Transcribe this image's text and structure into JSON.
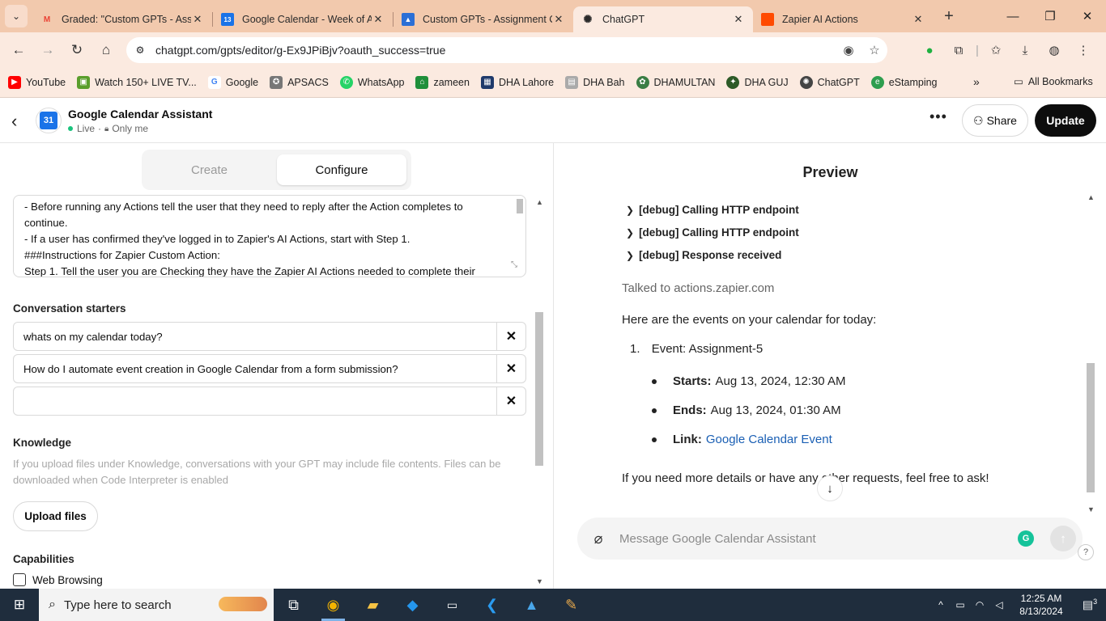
{
  "browser": {
    "tabs": [
      {
        "title": "Graded: \"Custom GPTs - Ass",
        "icon": "gmail-icon",
        "active": false
      },
      {
        "title": "Google Calendar - Week of A",
        "icon": "calendar-icon",
        "active": false
      },
      {
        "title": "Custom GPTs - Assignment C",
        "icon": "classroom-icon",
        "active": false
      },
      {
        "title": "ChatGPT",
        "icon": "chatgpt-icon",
        "active": true
      },
      {
        "title": "Zapier AI Actions",
        "icon": "zapier-icon",
        "active": false
      }
    ],
    "url": "chatgpt.com/gpts/editor/g-Ex9JPiBjv?oauth_success=true",
    "bookmarks": [
      {
        "label": "YouTube",
        "color": "#ff0000",
        "glyph": "▶"
      },
      {
        "label": "Watch 150+ LIVE TV...",
        "color": "#5a9e2c",
        "glyph": "▣"
      },
      {
        "label": "Google",
        "color": "#4285f4",
        "glyph": "G"
      },
      {
        "label": "APSACS",
        "color": "#555555",
        "glyph": "✪"
      },
      {
        "label": "WhatsApp",
        "color": "#25d366",
        "glyph": "✆"
      },
      {
        "label": "zameen",
        "color": "#1f8f3a",
        "glyph": "⌂"
      },
      {
        "label": "DHA Lahore",
        "color": "#1f3a6b",
        "glyph": "▦"
      },
      {
        "label": "DHA Bah",
        "color": "#999999",
        "glyph": "▤"
      },
      {
        "label": "DHAMULTAN",
        "color": "#3a7d44",
        "glyph": "✿"
      },
      {
        "label": "DHA GUJ",
        "color": "#2d5a27",
        "glyph": "✦"
      },
      {
        "label": "ChatGPT",
        "color": "#444444",
        "glyph": "✺"
      },
      {
        "label": "eStamping",
        "color": "#2e9e4f",
        "glyph": "e"
      }
    ],
    "all_bookmarks": "All Bookmarks"
  },
  "header": {
    "gpt_name": "Google Calendar Assistant",
    "avatar_text": "31",
    "status": "Live",
    "visibility": "Only me",
    "share_label": "Share",
    "update_label": "Update"
  },
  "editor": {
    "tab_create": "Create",
    "tab_configure": "Configure",
    "instructions_lines": [
      "- Before running any Actions tell the user that they need to reply after the Action completes to",
      "continue.",
      "- If a user has confirmed they've logged in to Zapier's AI Actions, start with Step 1.",
      "###Instructions for Zapier Custom Action:",
      "Step 1. Tell the user you are Checking they have the Zapier AI Actions needed to complete their"
    ],
    "starters_title": "Conversation starters",
    "starters": [
      "whats on my calendar today?",
      "How do I automate event creation in Google Calendar from a form submission?",
      ""
    ],
    "knowledge_title": "Knowledge",
    "knowledge_desc": "If you upload files under Knowledge, conversations with your GPT may include file contents. Files can be downloaded when Code Interpreter is enabled",
    "upload_label": "Upload files",
    "capabilities_title": "Capabilities",
    "capability_web": "Web Browsing"
  },
  "preview": {
    "title": "Preview",
    "debug_lines": [
      "[debug] Calling HTTP endpoint",
      "[debug] Calling HTTP endpoint",
      "[debug] Response received"
    ],
    "talked_to": "Talked to actions.zapier.com",
    "intro": "Here are the events on your calendar for today:",
    "item_number": "1.",
    "event_label": "Event:",
    "event_value": "Assignment-5",
    "starts_label": "Starts:",
    "starts_value": "Aug 13, 2024, 12:30 AM",
    "ends_label": "Ends:",
    "ends_value": "Aug 13, 2024, 01:30 AM",
    "link_label": "Link:",
    "link_value": "Google Calendar Event",
    "closing": "If you need more details or have any other requests, feel free to ask!",
    "composer_placeholder": "Message Google Calendar Assistant"
  },
  "taskbar": {
    "search_placeholder": "Type here to search",
    "time": "12:25 AM",
    "date": "8/13/2024",
    "notif_count": "3"
  }
}
